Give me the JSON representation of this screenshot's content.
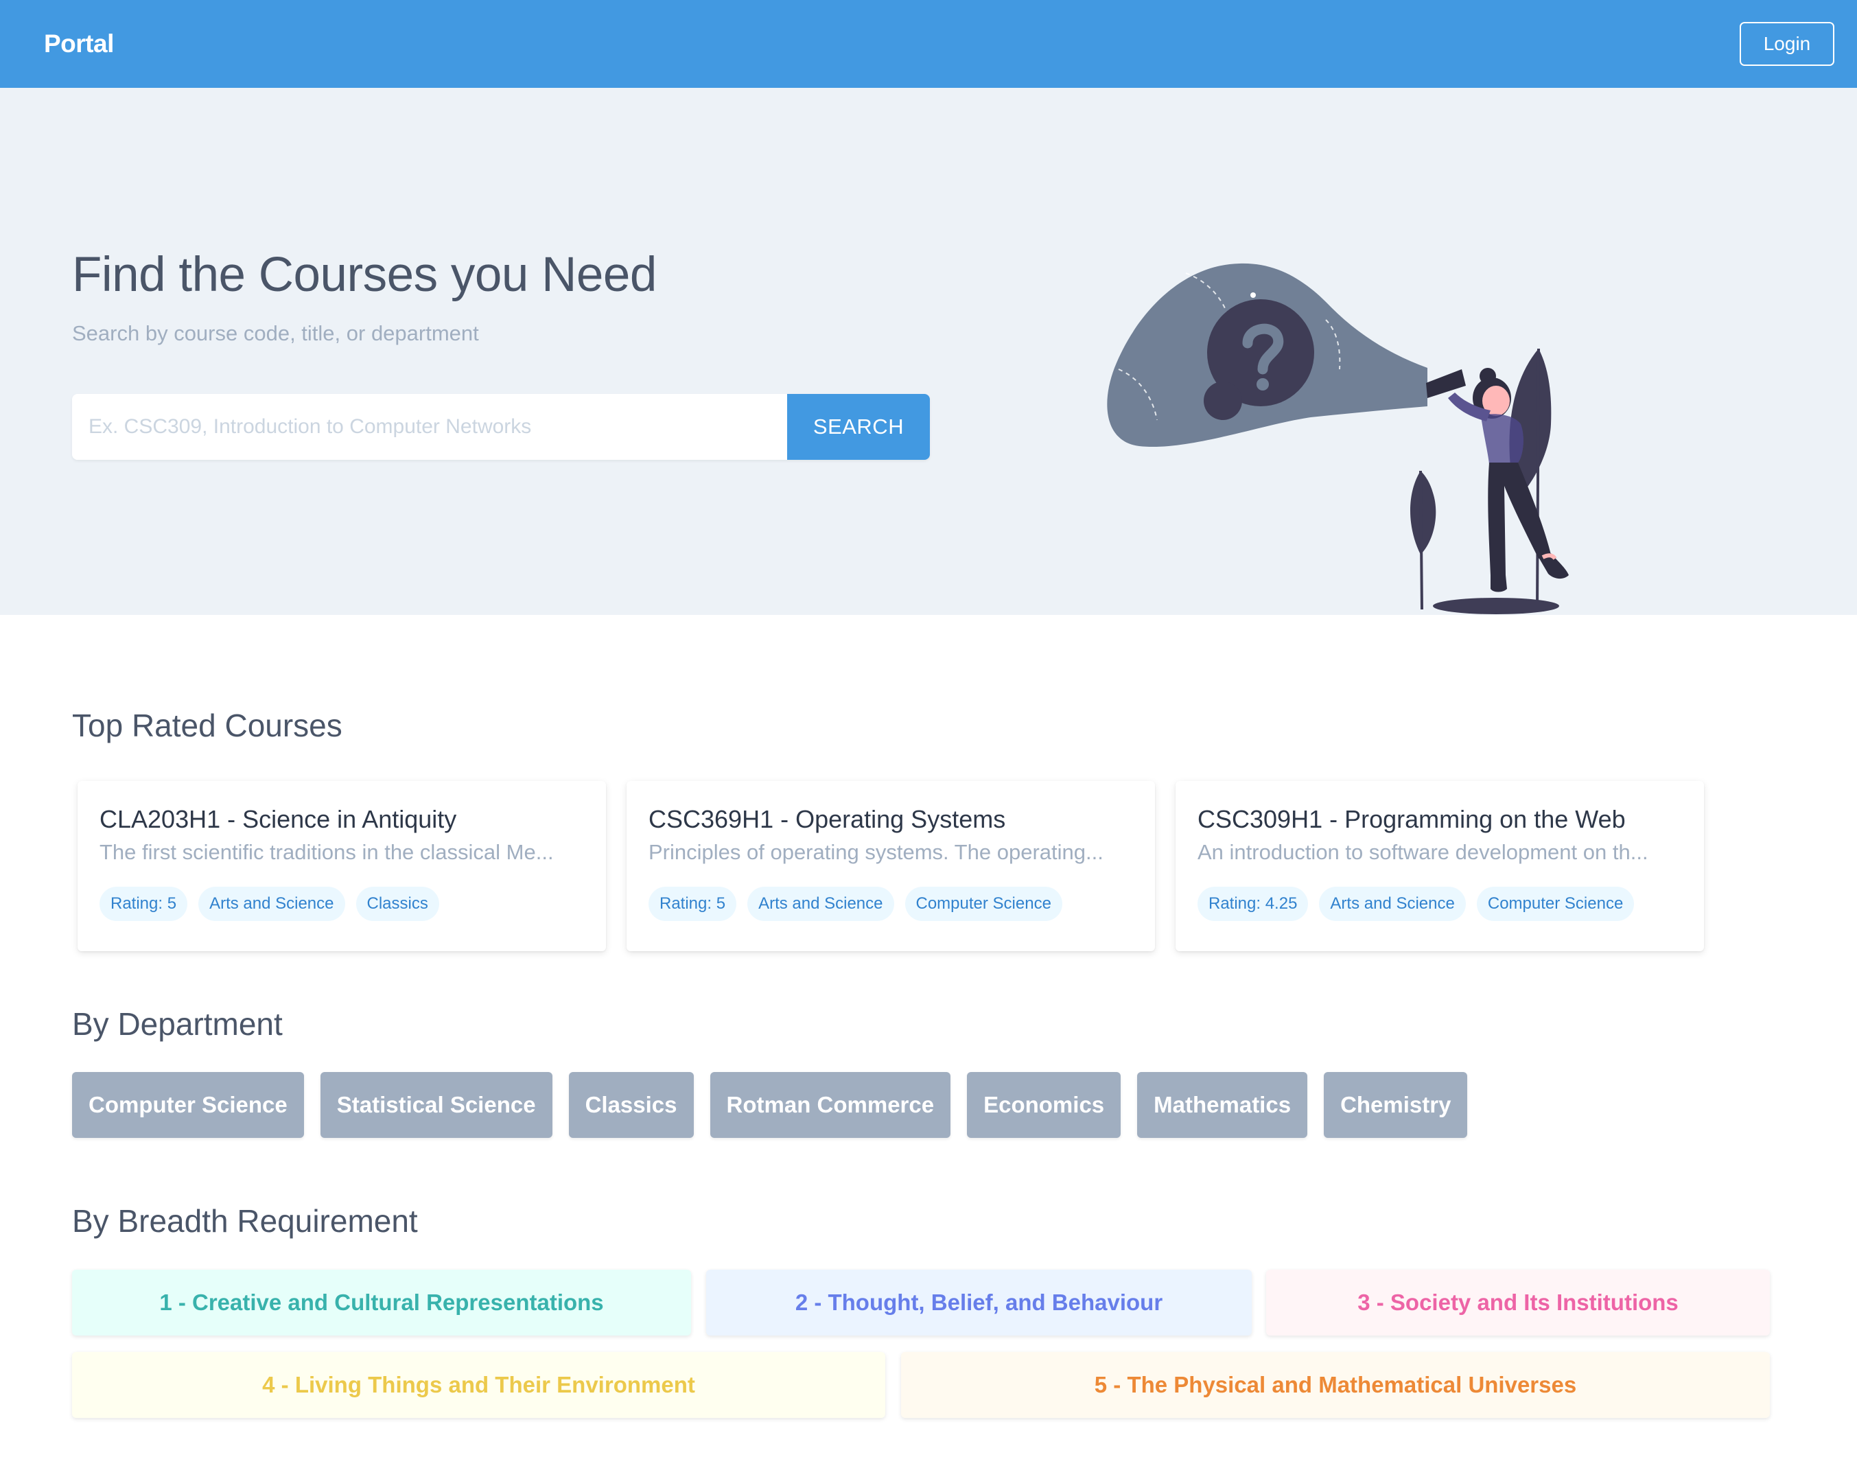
{
  "navbar": {
    "brand": "Portal",
    "login_label": "Login"
  },
  "hero": {
    "title": "Find the Courses you Need",
    "subtitle": "Search by course code, title, or department",
    "search_placeholder": "Ex. CSC309, Introduction to Computer Networks",
    "search_button": "SEARCH",
    "illustration_icon": "person-with-flashlight-question-icon"
  },
  "top_rated": {
    "title": "Top Rated Courses",
    "courses": [
      {
        "title": "CLA203H1 - Science in Antiquity",
        "description": "The first scientific traditions in the classical Me...",
        "tags": [
          "Rating: 5",
          "Arts and Science",
          "Classics"
        ]
      },
      {
        "title": "CSC369H1 - Operating Systems",
        "description": "Principles of operating systems. The operating...",
        "tags": [
          "Rating: 5",
          "Arts and Science",
          "Computer Science"
        ]
      },
      {
        "title": "CSC309H1 - Programming on the Web",
        "description": "An introduction to software development on th...",
        "tags": [
          "Rating: 4.25",
          "Arts and Science",
          "Computer Science"
        ]
      }
    ]
  },
  "departments": {
    "title": "By Department",
    "items": [
      "Computer Science",
      "Statistical Science",
      "Classics",
      "Rotman Commerce",
      "Economics",
      "Mathematics",
      "Chemistry"
    ]
  },
  "breadth": {
    "title": "By Breadth Requirement",
    "items": [
      {
        "label": "1 - Creative and Cultural Representations",
        "text_color": "#38b2ac",
        "bg_color": "#e6fffa"
      },
      {
        "label": "2 - Thought, Belief, and Behaviour",
        "text_color": "#667eea",
        "bg_color": "#ebf4ff"
      },
      {
        "label": "3 - Society and Its Institutions",
        "text_color": "#ed64a6",
        "bg_color": "#fff5f7"
      },
      {
        "label": "4 - Living Things and Their Environment",
        "text_color": "#ecc94b",
        "bg_color": "#fffff0"
      },
      {
        "label": "5 - The Physical and Mathematical Universes",
        "text_color": "#ed8936",
        "bg_color": "#fffaf0"
      }
    ]
  },
  "colors": {
    "accent": "#4299e1",
    "hero_bg": "#edf2f7",
    "dept_button": "#a0aec0"
  }
}
